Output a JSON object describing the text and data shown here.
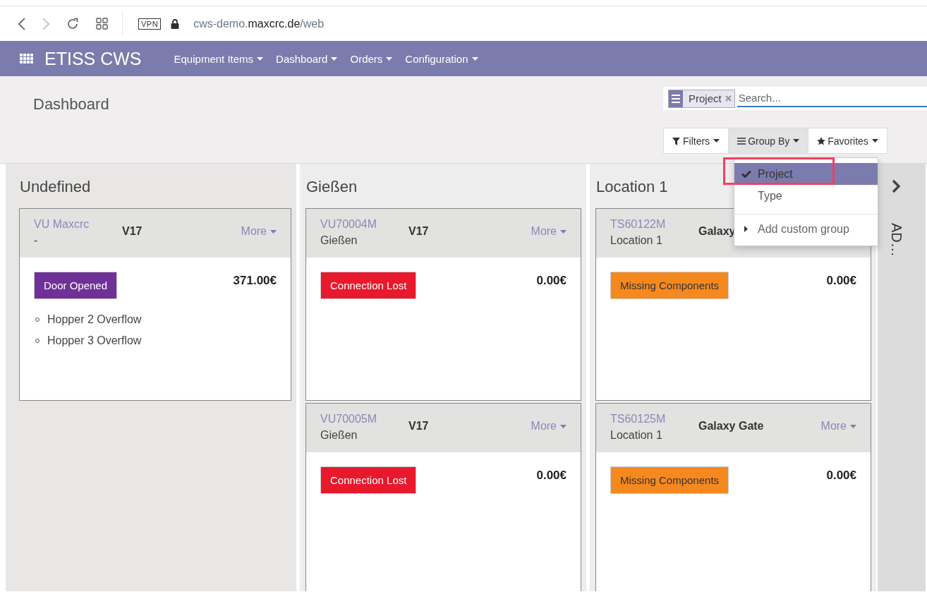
{
  "browser": {
    "vpn_label": "VPN",
    "url": {
      "subdomain": "cws-demo.",
      "domain": "maxcrc.de",
      "path": "/web"
    }
  },
  "navbar": {
    "app_name": "ETISS CWS",
    "menus": [
      "Equipment Items",
      "Dashboard",
      "Orders",
      "Configuration"
    ]
  },
  "control_panel": {
    "breadcrumb": "Dashboard",
    "search": {
      "facets": [
        {
          "label": "Project"
        }
      ],
      "placeholder": "Search..."
    },
    "buttons": [
      {
        "kind": "filter",
        "label": "Filters",
        "open": false
      },
      {
        "kind": "group",
        "label": "Group By",
        "open": true
      },
      {
        "kind": "star",
        "label": "Favorites",
        "open": false
      }
    ],
    "group_by_menu": {
      "items": [
        {
          "label": "Project",
          "selected": true
        },
        {
          "label": "Type",
          "selected": false
        }
      ],
      "custom_label": "Add custom group"
    }
  },
  "columns": [
    {
      "title": "Undefined",
      "cards": [
        {
          "code": "VU Maxcrc",
          "location": "-",
          "model": "V17",
          "more": "More",
          "tag": {
            "label": "Door Opened",
            "color": "#6f3198"
          },
          "amount": "371.00€",
          "items": [
            "Hopper 2 Overflow",
            "Hopper 3 Overflow"
          ]
        }
      ]
    },
    {
      "title": "Gießen",
      "cards": [
        {
          "code": "VU70004M",
          "location": "Gießen",
          "model": "V17",
          "more": "More",
          "tag": {
            "label": "Connection Lost",
            "color": "#e8192c"
          },
          "amount": "0.00€"
        },
        {
          "code": "VU70005M",
          "location": "Gießen",
          "model": "V17",
          "more": "More",
          "tag": {
            "label": "Connection Lost",
            "color": "#e8192c"
          },
          "amount": "0.00€"
        }
      ]
    },
    {
      "title": "Location 1",
      "cards": [
        {
          "code": "TS60122M",
          "location": "Location 1",
          "model": "Galaxy",
          "tag": {
            "label": "Missing Components",
            "color": "#f5891f"
          },
          "amount": "0.00€"
        },
        {
          "code": "TS60125M",
          "location": "Location 1",
          "model": "Galaxy Gate",
          "more": "More",
          "tag": {
            "label": "Missing Components",
            "color": "#f5891f"
          },
          "amount": "0.00€"
        }
      ]
    }
  ],
  "folded_column": {
    "title": "AD…"
  }
}
